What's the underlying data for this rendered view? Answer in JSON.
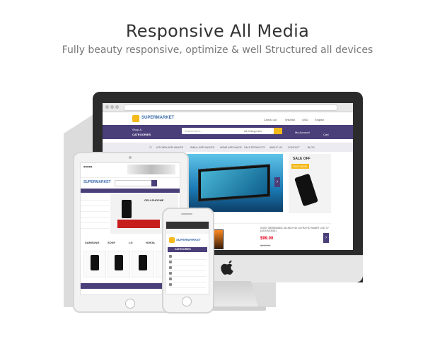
{
  "header": {
    "title": "Responsive All Media",
    "subtitle": "Fully beauty responsive, optimize & well Structured all devices"
  },
  "desktop": {
    "logo": "SUPERMARKET",
    "top_links": [
      "Check out",
      "Wishlist",
      "USD",
      "English"
    ],
    "shop_by": "Shop &",
    "categories": "CATEGORIES",
    "search_placeholder": "Search here...",
    "search_category": "All Categories",
    "account": "My Account",
    "cart": "Cart",
    "menu": [
      "KITCHEN APPLIANCES",
      "SMALL APPLIANCES",
      "HOME APPLIANCE",
      "SALE PRODUCTS",
      "ABOUT US",
      "CONTACT",
      "BLOG"
    ],
    "promo_title": "SALE OFF",
    "promo_btn": "BUY NOW",
    "product_title": "SONY XBR65X850C 65-INCH 4K ULTRA HD SMART LED TV (2015 MODEL)",
    "product_price": "$99.00",
    "product_old_price": "$120.00"
  },
  "tablet": {
    "logo": "SUPERMARKET",
    "banner_label": "CELLPHOPNE",
    "brands": [
      "SAMSUNG",
      "SONY",
      "LG",
      "NOKIA"
    ]
  },
  "phone": {
    "logo": "SUPERMARKET",
    "categories_title": "CATEGORIES"
  },
  "colors": {
    "brand_purple": "#4b3f7a",
    "accent_yellow": "#f4b91a",
    "price_red": "#e3001b",
    "logo_blue": "#3e6da8"
  },
  "icons": [
    "apple-logo-icon",
    "home-icon",
    "cart-icon",
    "search-icon",
    "chevron-right-icon",
    "chevron-left-icon"
  ]
}
